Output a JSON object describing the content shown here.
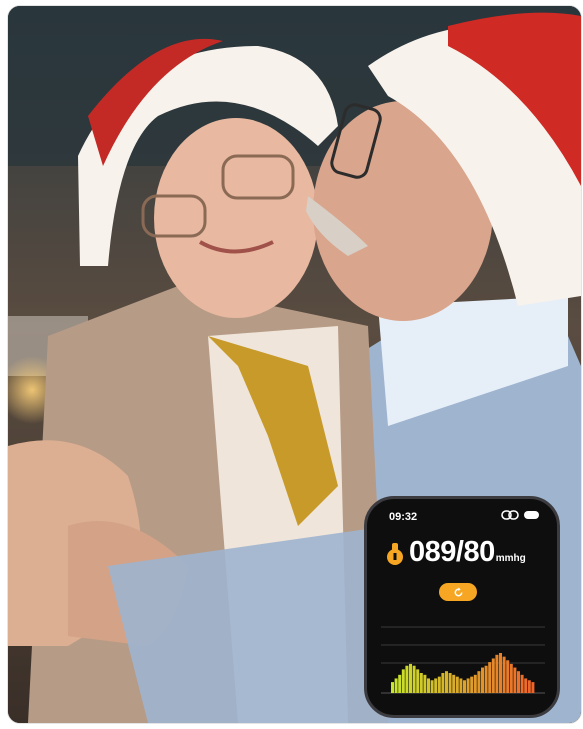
{
  "watch": {
    "time": "09:32",
    "reading_value": "089/80",
    "reading_unit": "mmhg",
    "icons": {
      "link": "link-icon",
      "battery": "battery-icon",
      "blood_pressure": "blood-pressure-icon",
      "refresh": "refresh-icon"
    },
    "colors": {
      "accent": "#f6a623",
      "bar_low": "#c8e62a",
      "bar_high": "#f0642a"
    }
  },
  "chart_data": {
    "type": "bar",
    "values": [
      6,
      8,
      10,
      13,
      15,
      16,
      15,
      13,
      11,
      10,
      8,
      7,
      8,
      9,
      11,
      12,
      11,
      10,
      9,
      8,
      7,
      8,
      9,
      10,
      12,
      14,
      15,
      17,
      19,
      21,
      22,
      20,
      18,
      16,
      14,
      12,
      10,
      8,
      7,
      6
    ]
  }
}
